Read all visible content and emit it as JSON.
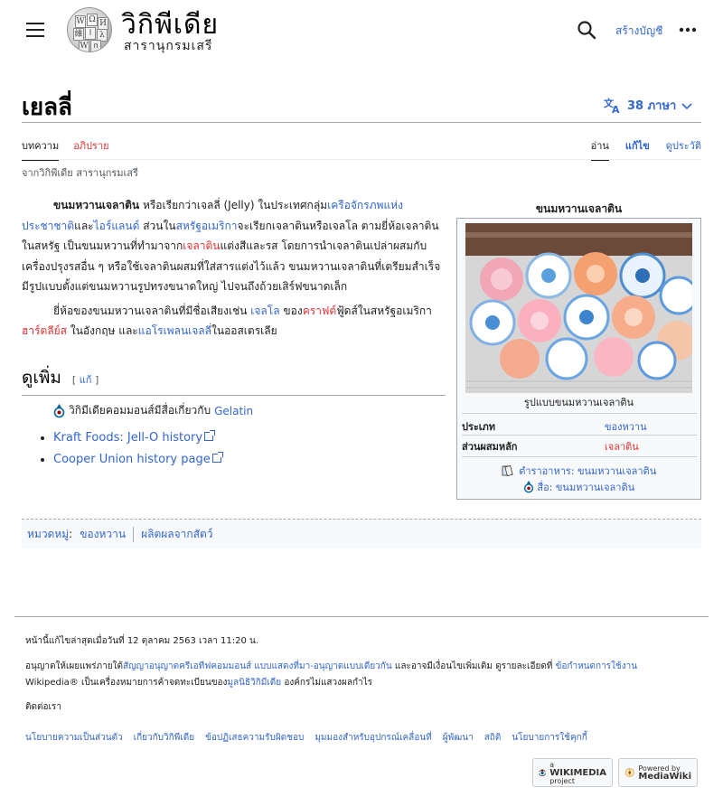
{
  "header": {
    "menu_icon": "hamburger-icon",
    "wordmark": "วิกิพีเดีย",
    "tagline": "สารานุกรมเสรี",
    "search_icon": "search-icon",
    "create_account": "สร้างบัญชี",
    "more_icon": "ellipsis-icon"
  },
  "page": {
    "title": "เยลลี่",
    "languages": "38 ภาษา",
    "tabs_left": [
      "บทความ",
      "อภิปราย"
    ],
    "tabs_right": [
      "อ่าน",
      "แก้ไข",
      "ดูประวัติ"
    ],
    "tagline": "จากวิกิพีเดีย สารานุกรมเสรี"
  },
  "article": {
    "p1": {
      "bold": "ขนมหวานเจลาติน",
      "t1": " หรือเรียกว่าเจลลี่ (Jelly) ในประเทศกลุ่ม",
      "l1": "เครือจักรภพแห่งประชาชาติ",
      "t2": "และ",
      "l2": "ไอร์แลนด์",
      "t3": " ส่วนใน",
      "l3": "สหรัฐอเมริกา",
      "t4": "จะเรียกเจลาตินหรือเจลโล ตามยี่ห้อเจลาตินในสหรัฐ เป็นขนมหวานที่ทำมาจาก",
      "l4": "เจลาติน",
      "t5": "แต่งสีและรส โดยการนำเจลาตินเปล่าผสมกับเครื่องปรุงรสอื่น ๆ หรือใช้เจลาตินผสมที่ใส่สารแต่งไว้แล้ว ขนมหวานเจลาตินที่เตรียมสำเร็จมีรูปแบบตั้งแต่ขนมหวานรูปทรงขนาดใหญ่ ไปจนถึงถ้วยเสิร์ฟขนาดเล็ก"
    },
    "p2": {
      "t1": "ยี่ห้อของขนมหวานเจลาตินที่มีชื่อเสียงเช่น ",
      "l1": "เจลโล",
      "t2": " ของ",
      "l2": "คราฟต์",
      "t3": "ฟู้ดส์ในสหรัฐอเมริกา ",
      "l3": "ฮาร์ตลีย์ส",
      "t4": " ในอังกฤษ และ",
      "l4": "แอโรเพลนเจลลี่",
      "t5": "ในออสเตรเลีย"
    },
    "see_also": {
      "heading": "ดูเพิ่ม",
      "edit_open": "[",
      "edit": "แก้",
      "edit_close": "]",
      "commons_text": "วิกิมีเดียคอมมอนส์มีสื่อเกี่ยวกับ ",
      "commons_link": "Gelatin",
      "links": [
        "Kraft Foods: Jell-O history",
        "Cooper Union history page"
      ]
    }
  },
  "infobox": {
    "title": "ขนมหวานเจลาติน",
    "caption": "รูปแบบขนมหวานเจลาติน",
    "rows": [
      {
        "key": "ประเภท",
        "value": "ของหวาน",
        "color": "#3366cc"
      },
      {
        "key": "ส่วนผสมหลัก",
        "value": "เจลาติน",
        "color": "#dd3333"
      }
    ],
    "recipe_prefix": "ตำราอาหาร:",
    "recipe_link": "ขนมหวานเจลาติน",
    "media_prefix": "สื่อ:",
    "media_link": "ขนมหวานเจลาติน"
  },
  "categories": {
    "label": "หมวดหมู่",
    "colon": ":",
    "items": [
      "ของหวาน",
      "ผลิตผลจากสัตว์"
    ]
  },
  "footer": {
    "last_edit": "หน้านี้แก้ไขล่าสุดเมื่อวันที่ 12 ตุลาคม 2563 เวลา 11:20 น.",
    "license_1": "อนุญาตให้เผยแพร่ภายใต้",
    "license_link": "สัญญาอนุญาตครีเอทีฟคอมมอนส์ แบบแสดงที่มา-อนุญาตแบบเดียวกัน",
    "license_2": " และอาจมีเงื่อนไขเพิ่มเติม ดูรายละเอียดที่ ",
    "terms_link": "ข้อกำหนดการใช้งาน",
    "trademark_1": "Wikipedia® เป็นเครื่องหมายการค้าจดทะเบียนของ",
    "foundation_link": "มูลนิธิวิกิมีเดีย",
    "trademark_2": " องค์กรไม่แสวงผลกำไร",
    "contact": "ติดต่อเรา",
    "links": [
      "นโยบายความเป็นส่วนตัว",
      "เกี่ยวกับวิกิพีเดีย",
      "ข้อปฏิเสธความรับผิดชอบ",
      "มุมมองสำหรับอุปกรณ์เคลื่อนที่",
      "ผู้พัฒนา",
      "สถิติ",
      "นโยบายการใช้คุกกี้"
    ],
    "wikimedia_badge_top": "a",
    "wikimedia_badge_main": "WIKIMEDIA",
    "wikimedia_badge_sub": "project",
    "mediawiki_badge_top": "Powered by",
    "mediawiki_badge_main": "MediaWiki"
  }
}
